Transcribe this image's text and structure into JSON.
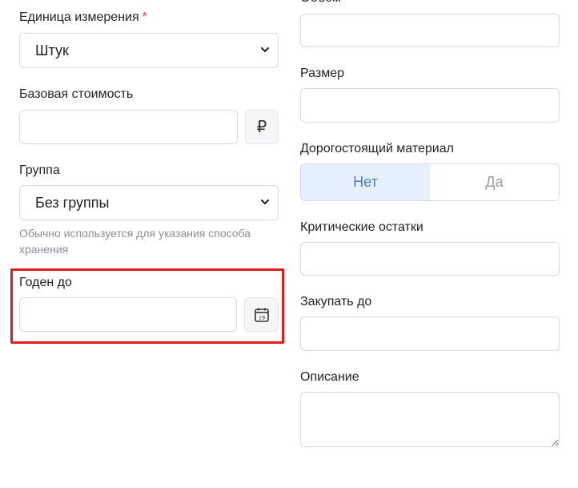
{
  "left": {
    "unit": {
      "label": "Единица измерения",
      "required_mark": "*",
      "value": "Штук"
    },
    "base_cost": {
      "label": "Базовая стоимость",
      "value": "",
      "currency_symbol": "₽"
    },
    "group": {
      "label": "Группа",
      "value": "Без группы",
      "hint": "Обычно используется для указания способа хранения"
    },
    "expiry": {
      "label": "Годен до",
      "value": "",
      "calendar_day": "19"
    }
  },
  "right": {
    "volume": {
      "label": "Объем",
      "value": ""
    },
    "size": {
      "label": "Размер",
      "value": ""
    },
    "expensive": {
      "label": "Дорогостоящий материал",
      "options": [
        "Нет",
        "Да"
      ],
      "selected": "Нет"
    },
    "critical": {
      "label": "Критические остатки",
      "value": ""
    },
    "buy_before": {
      "label": "Закупать до",
      "value": ""
    },
    "description": {
      "label": "Описание",
      "value": ""
    }
  },
  "colors": {
    "highlight": "#e01b1b",
    "toggle_active_bg": "#e6effd",
    "toggle_active_text": "#4a7fd4",
    "required": "#e0474c"
  },
  "icons": {
    "select_chevron": "chevron-down-icon",
    "calendar": "calendar-icon",
    "resize": "resize-handle-icon"
  }
}
